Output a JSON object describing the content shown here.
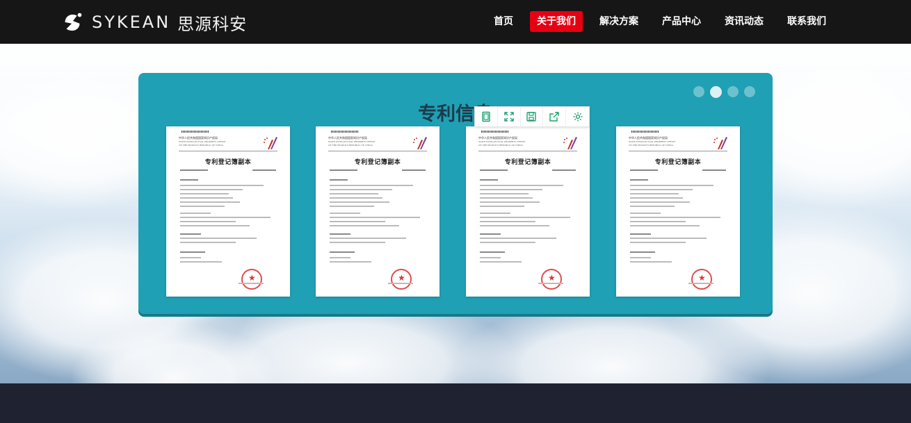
{
  "header": {
    "brand_en": "SYKEAN",
    "brand_cn": "思源科安",
    "logo_icon": "sykean-logo-icon",
    "nav": [
      {
        "label": "首页",
        "active": false
      },
      {
        "label": "关于我们",
        "active": true
      },
      {
        "label": "解决方案",
        "active": false
      },
      {
        "label": "产品中心",
        "active": false
      },
      {
        "label": "资讯动态",
        "active": false
      },
      {
        "label": "联系我们",
        "active": false
      }
    ]
  },
  "colors": {
    "header_bg": "#161616",
    "nav_active": "#e60012",
    "panel_bg": "#1fa0b4",
    "toolbar_icon": "#1aa06e",
    "footer_bg": "#1f2230"
  },
  "section": {
    "title": "专利信息",
    "carousel_dots": 4,
    "active_dot": 1
  },
  "certificates": [
    {
      "office_cn": "中华人民共和国国家知识产权局",
      "office_en_1": "STATE INTELLECTUAL PROPERTY OFFICE",
      "office_en_2": "OF THE PEOPLE'S REPUBLIC OF CHINA",
      "title": "专利登记簿副本"
    },
    {
      "office_cn": "中华人民共和国国家知识产权局",
      "office_en_1": "STATE INTELLECTUAL PROPERTY OFFICE",
      "office_en_2": "OF THE PEOPLE'S REPUBLIC OF CHINA",
      "title": "专利登记簿副本"
    },
    {
      "office_cn": "中华人民共和国国家知识产权局",
      "office_en_1": "STATE INTELLECTUAL PROPERTY OFFICE",
      "office_en_2": "OF THE PEOPLE'S REPUBLIC OF CHINA",
      "title": "专利登记簿副本"
    },
    {
      "office_cn": "中华人民共和国国家知识产权局",
      "office_en_1": "STATE INTELLECTUAL PROPERTY OFFICE",
      "office_en_2": "OF THE PEOPLE'S REPUBLIC OF CHINA",
      "title": "专利登记簿副本"
    }
  ],
  "toolbar": {
    "icons": [
      "page-icon",
      "fullscreen-icon",
      "save-icon",
      "share-icon",
      "settings-icon"
    ]
  }
}
